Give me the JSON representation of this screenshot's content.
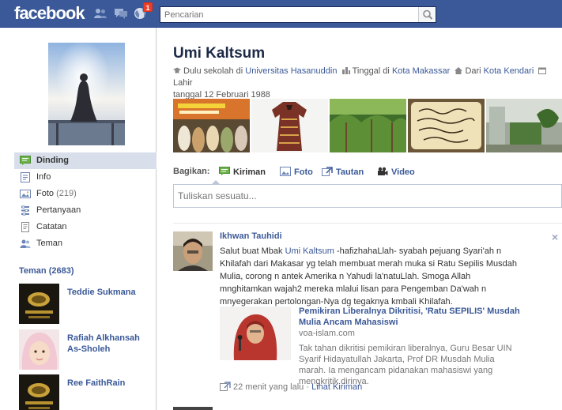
{
  "topbar": {
    "logo": "facebook",
    "notifications_count": "1",
    "search_placeholder": "Pencarian"
  },
  "left_nav": {
    "items": [
      {
        "label": "Dinding",
        "icon": "wall-icon",
        "count": ""
      },
      {
        "label": "Info",
        "icon": "info-icon",
        "count": ""
      },
      {
        "label": "Foto",
        "icon": "photos-icon",
        "count": "(219)"
      },
      {
        "label": "Pertanyaan",
        "icon": "questions-icon",
        "count": ""
      },
      {
        "label": "Catatan",
        "icon": "notes-icon",
        "count": ""
      },
      {
        "label": "Teman",
        "icon": "friends-icon",
        "count": ""
      }
    ]
  },
  "friends": {
    "header": "Teman (2683)",
    "list": [
      {
        "name": "Teddie Sukmana"
      },
      {
        "name": "Rafiah Alkhansah As-Sholeh"
      },
      {
        "name": "Ree FaithRain"
      }
    ]
  },
  "profile": {
    "name": "Umi Kaltsum",
    "education_prefix": "Dulu sekolah di",
    "education_link": "Universitas Hasanuddin",
    "lives_prefix": "Tinggal di",
    "lives_link": "Kota Makassar",
    "from_prefix": "Dari",
    "from_link": "Kota Kendari",
    "birthday_prefix": "Lahir",
    "birthday_value": "tanggal 12 Februari 1988"
  },
  "share": {
    "label": "Bagikan:",
    "tabs": [
      {
        "label": "Kiriman",
        "icon": "status-icon"
      },
      {
        "label": "Foto",
        "icon": "photo-icon"
      },
      {
        "label": "Tautan",
        "icon": "link-icon"
      },
      {
        "label": "Video",
        "icon": "video-icon"
      }
    ],
    "composer_placeholder": "Tuliskan sesuatu..."
  },
  "story": {
    "author": "Ikhwan Tauhidi",
    "text_before_mention": "Salut buat Mbak",
    "mention": "Umi Kaltsum",
    "text_after_mention": "-hafizhahaLlah- syabah pejuang Syari'ah n Khilafah dari Makasar yg telah membuat merah muka si Ratu Sepilis Musdah Mulia, corong n antek Amerika n Yahudi la'natuLlah. Smoga Allah mnghitamkan wajah2 mereka mlalui lisan para Pengemban Da'wah n mnyegerakan pertolongan-Nya dg tegaknya kmbali Khilafah.",
    "attachment": {
      "title": "Pemikiran Liberalnya Dikritisi, 'Ratu SEPILIS' Musdah Mulia Ancam Mahasiswi",
      "domain": "voa-islam.com",
      "description": "Tak tahan dikritisi pemikiran liberalnya, Guru Besar UIN Syarif Hidayatullah Jakarta, Prof DR Musdah Mulia marah. Ia mengancam pidanakan mahasiswi yang mengkritik dirinya."
    },
    "time": "22 menit yang lalu",
    "separator": "·",
    "view_post": "Lihat Kiriman",
    "close_glyph": "×"
  },
  "colors": {
    "brand_blue": "#3b5998",
    "nav_active_bg": "#d8dfea",
    "badge_red": "#f03d25"
  }
}
